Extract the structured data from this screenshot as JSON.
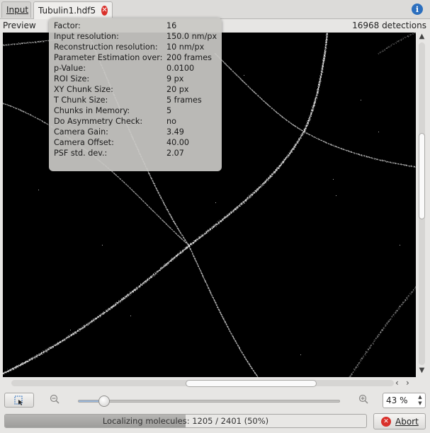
{
  "tabs": [
    {
      "label": "Input"
    },
    {
      "label": "Tubulin1.hdf5"
    }
  ],
  "header": {
    "preview_label": "Preview",
    "detections": "16968 detections"
  },
  "icons": {
    "tab_close": "close-icon",
    "info": "info-icon",
    "zoom_out": "zoom-out-icon",
    "zoom_in": "zoom-in-icon",
    "abort": "abort-icon",
    "tool": "select-tool-icon"
  },
  "parameters": [
    {
      "key": "Factor:",
      "value": "16"
    },
    {
      "key": "Input resolution:",
      "value": "150.0 nm/px"
    },
    {
      "key": "Reconstruction resolution:",
      "value": "10 nm/px"
    },
    {
      "key": "Parameter Estimation over:",
      "value": "200 frames"
    },
    {
      "key": "p-Value:",
      "value": "0.0100"
    },
    {
      "key": "ROI Size:",
      "value": "9 px"
    },
    {
      "key": "XY Chunk Size:",
      "value": "20 px"
    },
    {
      "key": "T Chunk Size:",
      "value": "5 frames"
    },
    {
      "key": "Chunks in Memory:",
      "value": "5"
    },
    {
      "key": "Do Asymmetry Check:",
      "value": "no"
    },
    {
      "key": "Camera Gain:",
      "value": "3.49"
    },
    {
      "key": "Camera Offset:",
      "value": "40.00"
    },
    {
      "key": "PSF std. dev.:",
      "value": "2.07"
    }
  ],
  "zoom": {
    "value": "43 %",
    "slider_fraction": 0.1
  },
  "progress": {
    "text": "Localizing molecules: 1205 / 2401 (50%)",
    "fraction": 0.5
  },
  "abort_label": "Abort",
  "colors": {
    "accent": "#2c6fbe",
    "close": "#d9302a",
    "canvas": "#000000"
  }
}
